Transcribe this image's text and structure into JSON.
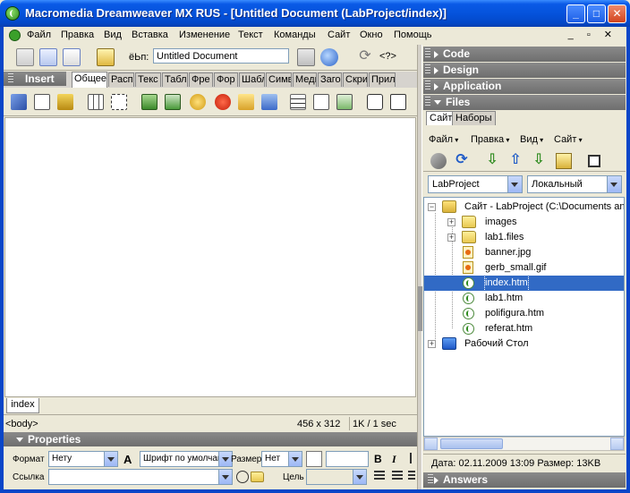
{
  "window": {
    "title": "Macromedia Dreamweaver MX RUS - [Untitled Document (LabProject/index)]",
    "minimize_label": "_",
    "maximize_label": "□",
    "close_label": "✕"
  },
  "menu": {
    "items": [
      "Файл",
      "Правка",
      "Вид",
      "Вставка",
      "Изменение",
      "Текст",
      "Команды",
      "Сайт",
      "Окно",
      "Помощь"
    ],
    "mdi_controls": "_ ▫ ✕"
  },
  "doc_toolbar": {
    "title_label": "ёЬп:",
    "title_value": "Untitled Document"
  },
  "insert_panel": {
    "header": "Insert",
    "tabs": [
      "Общее",
      "Расп",
      "Текс",
      "Табл",
      "Фре",
      "Фор",
      "Шабл",
      "Симв",
      "Меди",
      "Заго",
      "Скри",
      "Прил"
    ],
    "icons": [
      "hyperlink-icon",
      "email-link-icon",
      "named-anchor-icon",
      "table-icon",
      "layer-icon",
      "image-icon",
      "rollover-image-icon",
      "fireworks-html-icon",
      "flash-icon",
      "navigation-bar-icon",
      "horizontal-rule-icon",
      "date-icon",
      "tabular-data-icon",
      "comment-icon",
      "tag-chooser-icon"
    ]
  },
  "document": {
    "tab": "index",
    "status_tag": "<body>",
    "window_size": "456 x 312",
    "file_weight": "1K / 1 sec"
  },
  "properties": {
    "header": "Properties",
    "format_label": "Формат",
    "format_value": "Нету",
    "font_value": "Шрифт по умолчан",
    "size_label": "Размер:",
    "size_value": "Нет",
    "bold": "B",
    "italic": "I",
    "link_label": "Ссылка",
    "target_label": "Цель"
  },
  "right_panels": {
    "code": "Code",
    "design": "Design",
    "application": "Application",
    "files": "Files",
    "answers": "Answers"
  },
  "files_panel": {
    "tabs": [
      "Сайт",
      "Наборы"
    ],
    "menu": [
      "Файл",
      "Правка",
      "Вид",
      "Сайт"
    ],
    "site_select": "LabProject",
    "view_select": "Локальный",
    "tree": [
      {
        "label": "Сайт - LabProject (C:\\Documents and",
        "type": "site-root"
      },
      {
        "label": "images",
        "type": "folder"
      },
      {
        "label": "lab1.files",
        "type": "folder"
      },
      {
        "label": "banner.jpg",
        "type": "image"
      },
      {
        "label": "gerb_small.gif",
        "type": "image"
      },
      {
        "label": "index.htm",
        "type": "htm"
      },
      {
        "label": "lab1.htm",
        "type": "htm"
      },
      {
        "label": "polifigura.htm",
        "type": "htm"
      },
      {
        "label": "referat.htm",
        "type": "htm"
      },
      {
        "label": "Рабочий Стол",
        "type": "desktop"
      }
    ],
    "selected": "index.htm",
    "status": "Дата: 02.11.2009 13:09  Размер: 13KB"
  }
}
